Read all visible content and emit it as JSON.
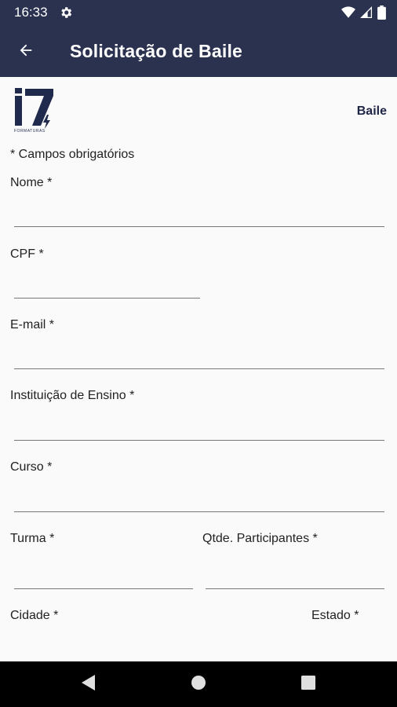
{
  "status_bar": {
    "time": "16:33",
    "icons": [
      "gear-icon",
      "wifi-icon",
      "signal-icon",
      "battery-icon"
    ]
  },
  "app_bar": {
    "back_icon": "arrow-left-icon",
    "title": "Solicitação de Baile"
  },
  "header": {
    "logo_caption": "FORMATURAS",
    "event_type": "Baile"
  },
  "form": {
    "required_note": "* Campos obrigatórios",
    "fields": {
      "nome": {
        "label": "Nome *",
        "value": ""
      },
      "cpf": {
        "label": "CPF *",
        "value": ""
      },
      "email": {
        "label": "E-mail *",
        "value": ""
      },
      "instituicao": {
        "label": "Instituição de Ensino *",
        "value": ""
      },
      "curso": {
        "label": "Curso *",
        "value": ""
      },
      "turma": {
        "label": "Turma *",
        "value": ""
      },
      "participantes": {
        "label": "Qtde. Participantes *",
        "value": ""
      },
      "cidade": {
        "label": "Cidade *",
        "value": ""
      },
      "estado": {
        "label": "Estado *",
        "value": ""
      }
    }
  },
  "nav_bar": {
    "icons": [
      "back-triangle-icon",
      "home-circle-icon",
      "recents-square-icon"
    ]
  },
  "colors": {
    "primary": "#2b3250",
    "background": "#fafafa",
    "logo": "#1f2a4d"
  }
}
